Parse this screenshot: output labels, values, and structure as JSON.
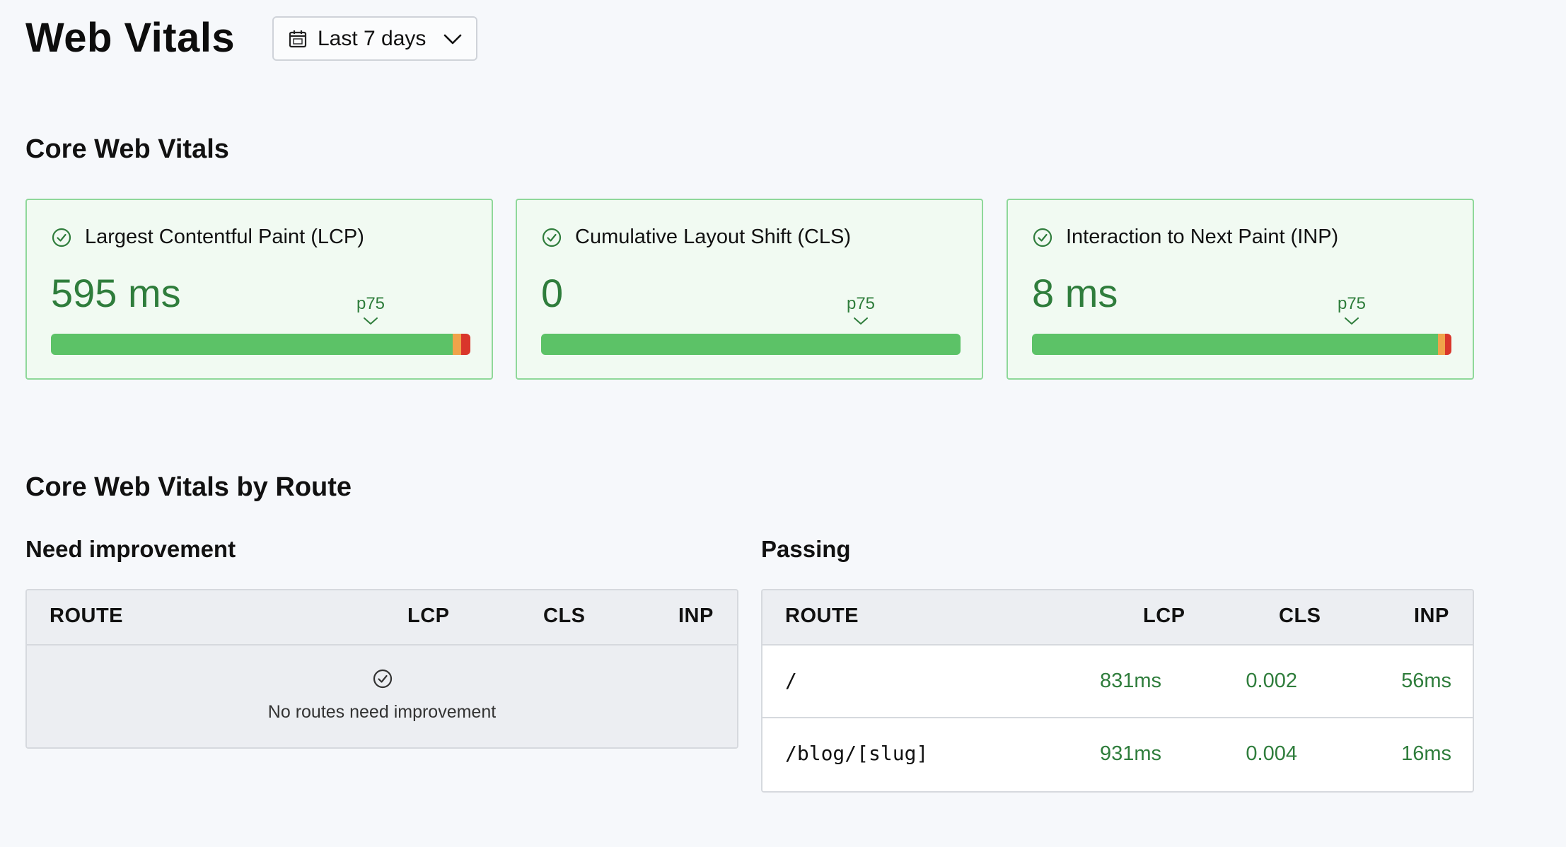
{
  "header": {
    "title": "Web Vitals",
    "range_label": "Last 7 days"
  },
  "core": {
    "title": "Core Web Vitals",
    "cards": [
      {
        "name": "Largest Contentful Paint (LCP)",
        "value": "595 ms",
        "marker": "p75",
        "good_pct": 95.7,
        "mid_pct": 2.1,
        "poor_pct": 2.2
      },
      {
        "name": "Cumulative Layout Shift (CLS)",
        "value": "0",
        "marker": "p75",
        "good_pct": 100,
        "mid_pct": 0,
        "poor_pct": 0
      },
      {
        "name": "Interaction to Next Paint (INP)",
        "value": "8 ms",
        "marker": "p75",
        "good_pct": 96.8,
        "mid_pct": 1.6,
        "poor_pct": 1.6
      }
    ]
  },
  "by_route": {
    "title": "Core Web Vitals by Route",
    "need_improvement": {
      "title": "Need improvement",
      "columns": [
        "ROUTE",
        "LCP",
        "CLS",
        "INP"
      ],
      "empty_message": "No routes need improvement"
    },
    "passing": {
      "title": "Passing",
      "columns": [
        "ROUTE",
        "LCP",
        "CLS",
        "INP"
      ],
      "rows": [
        {
          "route": "/",
          "lcp": "831ms",
          "cls": "0.002",
          "inp": "56ms"
        },
        {
          "route": "/blog/[slug]",
          "lcp": "931ms",
          "cls": "0.004",
          "inp": "16ms"
        }
      ]
    }
  },
  "colors": {
    "good": "#5cc267",
    "needs_improvement": "#f0a34a",
    "poor": "#d9362b",
    "value_text": "#2f7d3c",
    "card_border": "#8fd89a",
    "card_bg": "#f1faf2"
  },
  "icons": {
    "range": "calendar-icon",
    "range_toggle": "chevron-down-icon",
    "status": "check-circle-icon",
    "marker": "caret-down-icon"
  }
}
